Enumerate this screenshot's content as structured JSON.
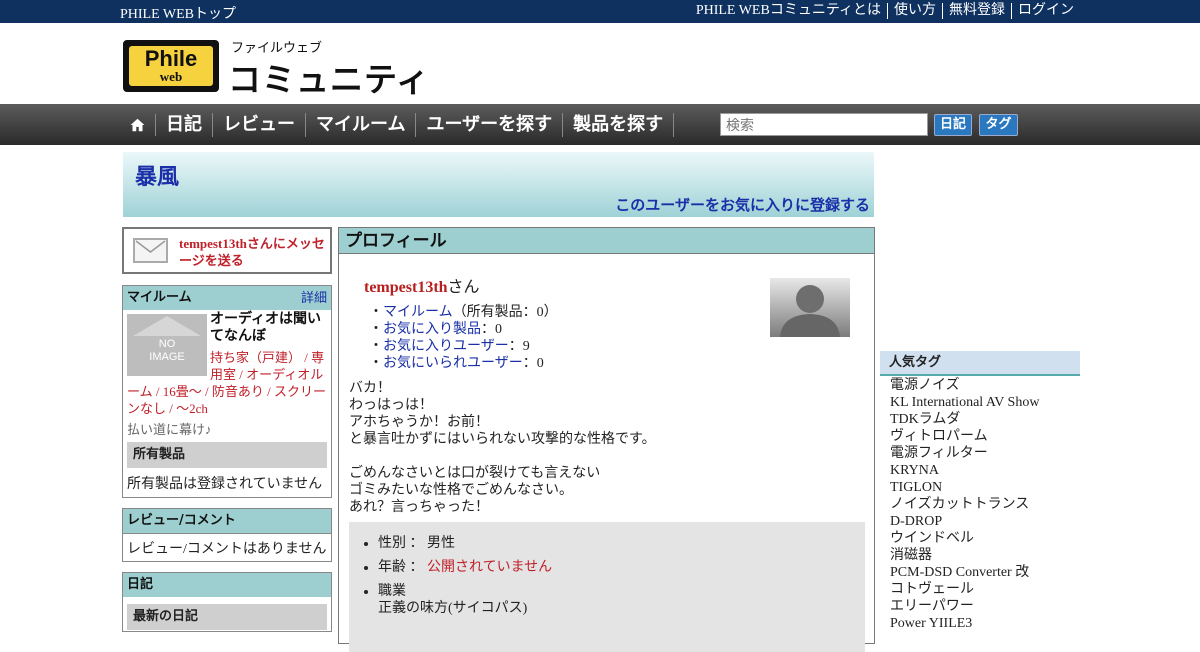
{
  "topbar": {
    "home_link": "PHILE WEBトップ",
    "links": [
      "PHILE WEBコミュニティとは",
      "使い方",
      "無料登録",
      "ログイン"
    ]
  },
  "logo": {
    "phile": "Phile",
    "web": "web",
    "kana": "ファイルウェブ",
    "main": "コミュニティ"
  },
  "nav": {
    "items": [
      "日記",
      "レビュー",
      "マイルーム",
      "ユーザーを探す",
      "製品を探す"
    ],
    "search_placeholder": "検索",
    "btn_diary": "日記",
    "btn_tag": "タグ"
  },
  "banner": {
    "name": "暴風",
    "favorite_link": "このユーザーをお気に入りに登録する"
  },
  "message": {
    "label": "tempest13thさんにメッセージを送る"
  },
  "myroom": {
    "title": "マイルーム",
    "detail": "詳細",
    "noimage_l1": "NO",
    "noimage_l2": "IMAGE",
    "room_title": "オーディオは聞いてなんぼ",
    "room_tags_l1": "持ち家（戸建） / 専用室 / オーディオル",
    "room_tags_l2": "ーム / 16畳～ / 防音あり / スクリー",
    "room_tags_l3": "ンなし / ～2ch",
    "room_comment": "払い道に幕け♪",
    "owned_title": "所有製品",
    "owned_empty": "所有製品は登録されていません"
  },
  "review": {
    "title": "レビュー/コメント",
    "empty": "レビュー/コメントはありません"
  },
  "diary": {
    "title": "日記",
    "latest": "最新の日記"
  },
  "profile": {
    "title": "プロフィール",
    "username": "tempest13th",
    "san": "さん",
    "myroom_link": "マイルーム",
    "myroom_count": "（所有製品：0）",
    "fav_products_link": "お気に入り製品",
    "fav_products_count": "：0",
    "fav_users_link": "お気に入りユーザー",
    "fav_users_count": "：9",
    "faved_link": "お気にいられユーザー",
    "faved_count": "：0",
    "bio_1": "バカ！",
    "bio_2": "わっはっは！",
    "bio_3": "アホちゃうか！お前！",
    "bio_4": "と暴言吐かずにはいられない攻撃的な性格です。",
    "bio_5": "ごめんなさいとは口が裂けても言えない",
    "bio_6": "ゴミみたいな性格でごめんなさい。",
    "bio_7": "あれ？言っちゃった！",
    "gender_label": "性別 ： ",
    "gender_value": "男性",
    "age_label": "年齢 ： ",
    "age_value": "公開されていません",
    "job_label": "職業",
    "job_value": "正義の味方(サイコパス)"
  },
  "tags": {
    "title": "人気タグ",
    "items": [
      "電源ノイズ",
      "KL International AV Show",
      "TDKラムダ",
      "ヴィトロパーム",
      "電源フィルター",
      "KRYNA",
      "TIGLON",
      "ノイズカットトランス",
      "D-DROP",
      "ウインドベル",
      "消磁器",
      "PCM-DSD Converter 改",
      "コトヴェール",
      "エリーパワー",
      "Power YIILE3"
    ]
  },
  "colors": {
    "topbar": "#0e3160",
    "accent_teal": "#9ecfd0",
    "link": "#1a2fa8",
    "red": "#c0202a"
  }
}
